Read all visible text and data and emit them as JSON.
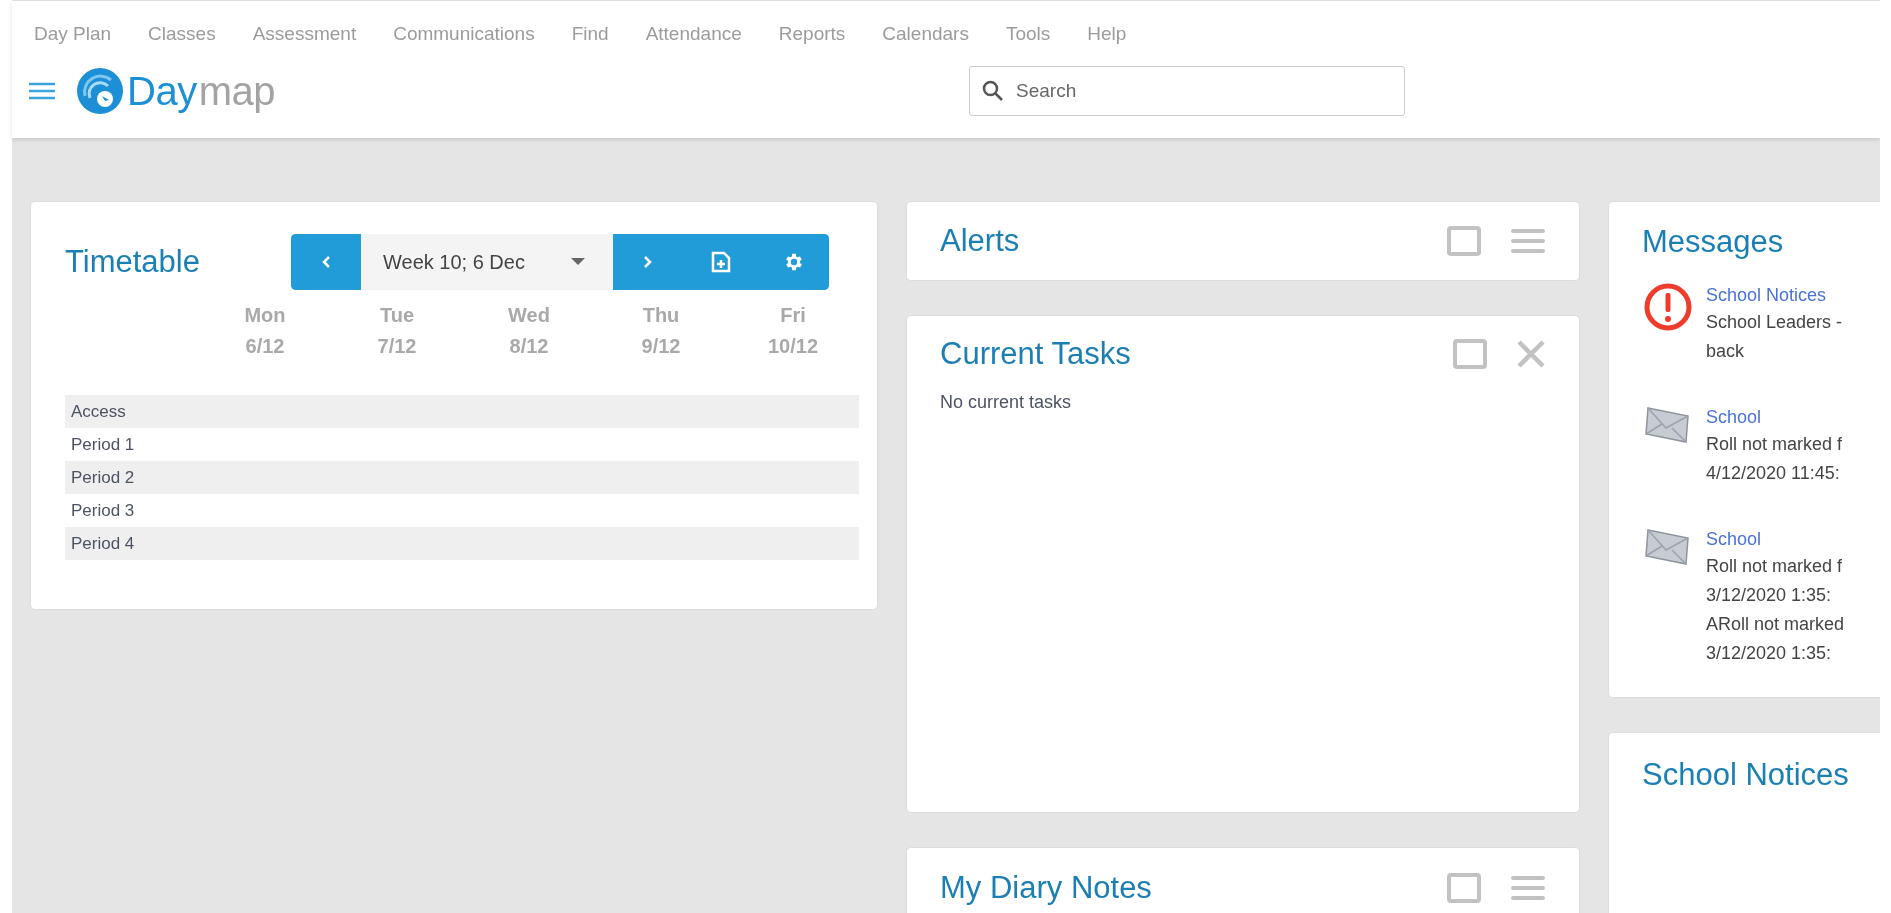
{
  "top_menu": [
    {
      "label": "Day Plan"
    },
    {
      "label": "Classes"
    },
    {
      "label": "Assessment"
    },
    {
      "label": "Communications"
    },
    {
      "label": "Find"
    },
    {
      "label": "Attendance"
    },
    {
      "label": "Reports"
    },
    {
      "label": "Calendars"
    },
    {
      "label": "Tools"
    },
    {
      "label": "Help"
    }
  ],
  "logo": {
    "part_1": "Day",
    "part_2": "map"
  },
  "search": {
    "placeholder": "Search"
  },
  "timetable": {
    "title": "Timetable",
    "week": "Week 10; 6 Dec",
    "days": [
      {
        "day": "Mon",
        "date": "6/12"
      },
      {
        "day": "Tue",
        "date": "7/12"
      },
      {
        "day": "Wed",
        "date": "8/12"
      },
      {
        "day": "Thu",
        "date": "9/12"
      },
      {
        "day": "Fri",
        "date": "10/12"
      }
    ],
    "rows": [
      "Access",
      "Period 1",
      "Period 2",
      "Period 3",
      "Period 4"
    ]
  },
  "alerts": {
    "title": "Alerts",
    "controls": [
      {
        "kind": "maximize"
      },
      {
        "kind": "menu"
      }
    ]
  },
  "current_tasks": {
    "title": "Current Tasks",
    "controls": [
      {
        "kind": "maximize"
      },
      {
        "kind": "close"
      }
    ],
    "empty_text": "No current tasks"
  },
  "diary_notes": {
    "title": "My Diary Notes",
    "controls": [
      {
        "kind": "maximize"
      },
      {
        "kind": "menu"
      }
    ]
  },
  "messages": {
    "title": "Messages",
    "items": [
      {
        "kind": "alert",
        "sender": "School Notices",
        "lines": [
          "School Leaders -",
          "back"
        ]
      },
      {
        "kind": "mail",
        "sender": "School",
        "lines": [
          "Roll not marked f",
          "4/12/2020 11:45:"
        ]
      },
      {
        "kind": "mail",
        "sender": "School",
        "lines": [
          "Roll not marked f",
          "3/12/2020 1:35:",
          "ARoll not marked",
          "3/12/2020 1:35:"
        ]
      }
    ]
  },
  "school_notices": {
    "title": "School Notices"
  }
}
